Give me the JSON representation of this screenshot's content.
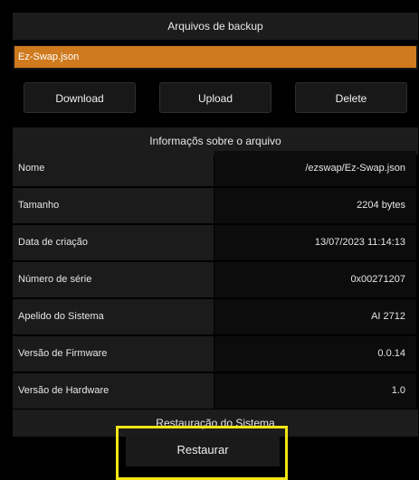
{
  "backup": {
    "header": "Arquivos de backup",
    "selected_file": "Ez-Swap.json"
  },
  "actions": {
    "download": "Download",
    "upload": "Upload",
    "delete": "Delete"
  },
  "info": {
    "header": "Informaçõs sobre o arquivo",
    "rows": [
      {
        "key": "Nome",
        "value": "/ezswap/Ez-Swap.json"
      },
      {
        "key": "Tamanho",
        "value": "2204 bytes"
      },
      {
        "key": "Data de criação",
        "value": "13/07/2023 11:14:13"
      },
      {
        "key": "Número de série",
        "value": "0x00271207"
      },
      {
        "key": "Apelido do Sistema",
        "value": "AI 2712"
      },
      {
        "key": "Versão de Firmware",
        "value": "0.0.14"
      },
      {
        "key": "Versão de Hardware",
        "value": "1.0"
      }
    ]
  },
  "restore": {
    "header": "Restauração do Sistema",
    "button": "Restaurar"
  },
  "colors": {
    "selected_file_bg": "#cf7a1e",
    "highlight_border": "#f2e515"
  }
}
